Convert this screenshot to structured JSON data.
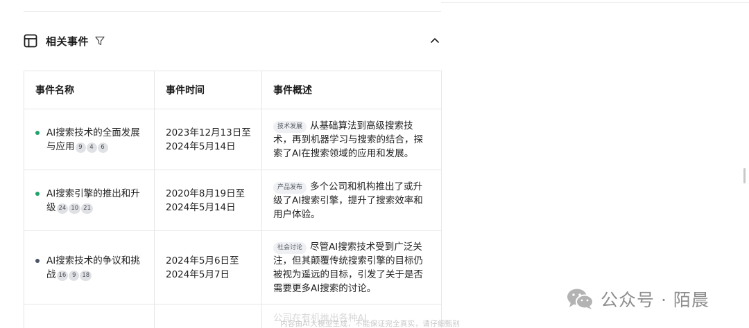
{
  "section": {
    "title": "相关事件",
    "icons": {
      "section": "table-icon",
      "filter": "filter-icon",
      "collapse": "chevron-up-icon"
    }
  },
  "table": {
    "headers": [
      "事件名称",
      "事件时间",
      "事件概述"
    ],
    "rows": [
      {
        "name": "AI搜索技术的全面发展与应用",
        "refs": [
          "9",
          "4",
          "6"
        ],
        "time": "2023年12月13日至2024年5月14日",
        "tag": "技术发展",
        "summary": "从基础算法到高级搜索技术，再到机器学习与搜索的结合，探索了AI在搜索领域的应用和发展。",
        "dot_color": "#1fa36a"
      },
      {
        "name": "AI搜索引擎的推出和升级",
        "refs": [
          "24",
          "10",
          "21"
        ],
        "time": "2020年8月19日至2024年5月14日",
        "tag": "产品发布",
        "summary": "多个公司和机构推出了或升级了AI搜索引擎，提升了搜索效率和用户体验。",
        "dot_color": "#1fa36a"
      },
      {
        "name": "AI搜索技术的争议和挑战",
        "refs": [
          "16",
          "9",
          "18"
        ],
        "time": "2024年5月6日至2024年5月7日",
        "tag": "社会讨论",
        "summary": "尽管AI搜索技术受到广泛关注，但其颠覆传统搜索引擎的目标仍被视为遥远的目标，引发了关于是否需要更多AI搜索的讨论。",
        "dot_color": "#4a5468"
      }
    ],
    "partial_row_text": "公司在有机推出各种AI"
  },
  "footer": {
    "disclaimer": "内容由AI大模型生成，不能保证完全真实，请仔细甄别"
  },
  "brand": {
    "text": "公众号 · 陌晨",
    "icon": "wechat-icon"
  }
}
